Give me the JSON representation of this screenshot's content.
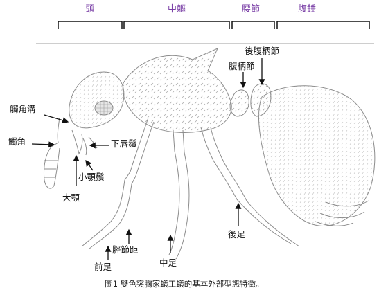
{
  "sections": {
    "head": "頭",
    "mesosoma": "中軀",
    "petiole": "腰節",
    "gaster": "腹錘"
  },
  "labels": {
    "antennal_scrobe": "觸角溝",
    "antenna": "觸角",
    "labial_palp": "下唇鬚",
    "maxillary_palp": "小顎鬚",
    "mandible": "大顎",
    "tibial_spur": "脛節距",
    "foreleg": "前足",
    "midleg": "中足",
    "hindleg": "後足",
    "petiole_node": "腹柄節",
    "postpetiole": "後腹柄節"
  },
  "caption": "圖1 雙色突胸家蟻工蟻的基本外部型態特徵。",
  "colors": {
    "section_text": "#7a3fa6",
    "ink": "#111111",
    "sketch": "#8c8c8c",
    "rule": "#bdbdbd"
  }
}
